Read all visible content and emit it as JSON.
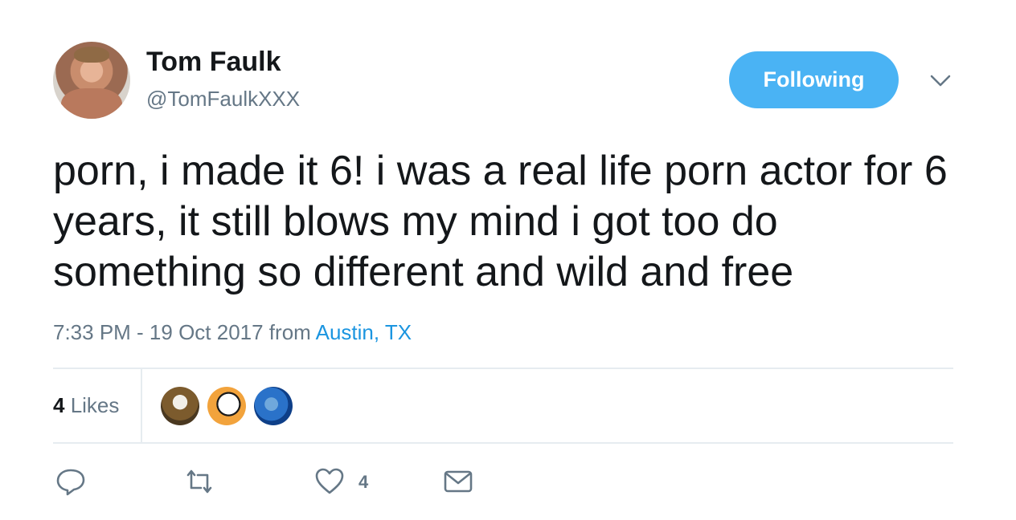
{
  "author": {
    "name": "Tom Faulk",
    "handle": "@TomFaulkXXX"
  },
  "follow_button": {
    "label": "Following",
    "color": "#4ab3f4"
  },
  "tweet": {
    "text": "porn, i made it 6! i was a real life porn actor for 6 years, it still blows my mind i got too do something so different and wild and free"
  },
  "meta": {
    "timestamp": "7:33 PM - 19 Oct 2017 from ",
    "location": "Austin, TX"
  },
  "stats": {
    "likes_count": "4",
    "likes_label": " Likes"
  },
  "actions": {
    "reply_icon": "reply-icon",
    "retweet_icon": "retweet-icon",
    "like_icon": "heart-icon",
    "like_count": "4",
    "dm_icon": "envelope-icon"
  },
  "colors": {
    "link": "#1b95e0",
    "secondary_text": "#657786",
    "divider": "#e6ecf0"
  }
}
